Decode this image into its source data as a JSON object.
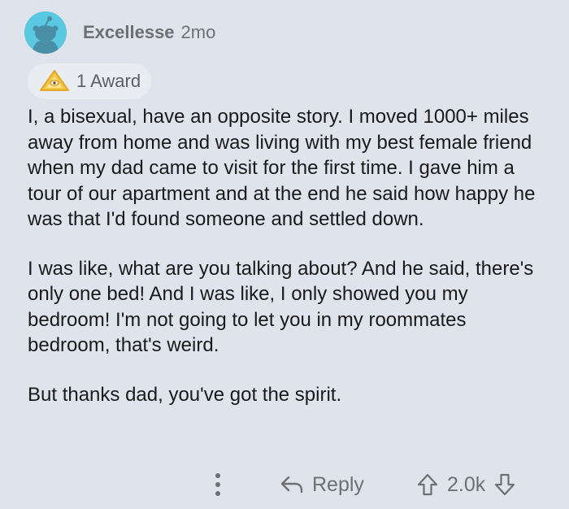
{
  "comment": {
    "author": "Excellesse",
    "age": "2mo",
    "award_label": "1 Award",
    "paragraphs": [
      "I, a bisexual, have an opposite story. I moved 1000+ miles away from home and was living with my best female friend when my dad came to visit for the first time. I gave him a tour of our apartment and at the end he said how happy he was that I'd found someone and settled down.",
      "I was like, what are you talking about? And he said, there's only one bed! And I was like, I only showed you my bedroom! I'm not going to let you in my roommates bedroom, that's weird.",
      "But thanks dad, you've got the spirit."
    ]
  },
  "actions": {
    "more_icon": "vertical-ellipsis-icon",
    "reply_icon": "reply-arrow-icon",
    "reply_label": "Reply",
    "upvote_icon": "upvote-arrow-icon",
    "score": "2.0k",
    "downvote_icon": "downvote-arrow-icon"
  },
  "colors": {
    "background": "#dfe4ec",
    "avatar": "#5ac8e0",
    "award_pill": "#e9ecf1",
    "muted_text": "#6e6f72",
    "body_text": "#1a1a1b"
  }
}
